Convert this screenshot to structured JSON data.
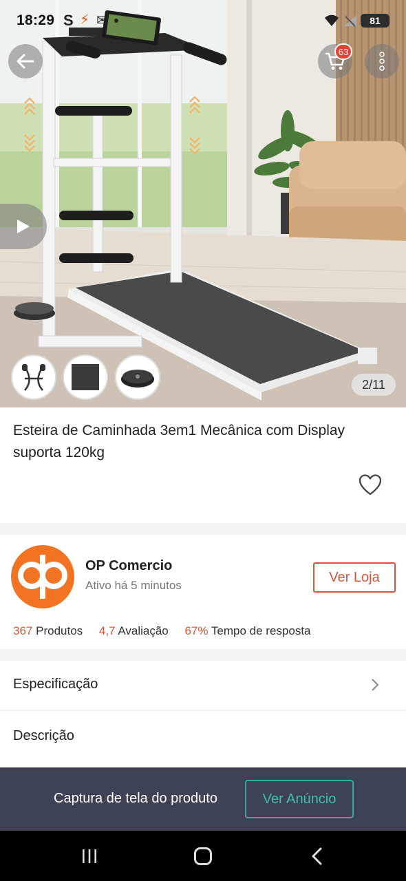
{
  "status_bar": {
    "time": "18:29",
    "s_glyph": "S",
    "battery": "81"
  },
  "header": {
    "cart_count": "63"
  },
  "gallery": {
    "counter": "2/11"
  },
  "product": {
    "title": "Esteira de Caminhada 3em1 Mecânica  com Display suporta 120kg"
  },
  "seller": {
    "name": "OP Comercio",
    "active": "Ativo há 5 minutos",
    "visit_label": "Ver Loja",
    "products_count": "367",
    "products_label": "Produtos",
    "rating": "4,7",
    "rating_label": "Avaliação",
    "response_rate": "67%",
    "response_label": "Tempo de resposta"
  },
  "sections": {
    "spec": "Especificação",
    "desc": "Descrição"
  },
  "bottom_bar": {
    "text": "Captura de tela do produto",
    "button": "Ver Anúncio"
  },
  "colors": {
    "accent": "#d9553b",
    "teal": "#3fbfae",
    "bar_bg": "#3e4255",
    "logo": "#f27422"
  }
}
